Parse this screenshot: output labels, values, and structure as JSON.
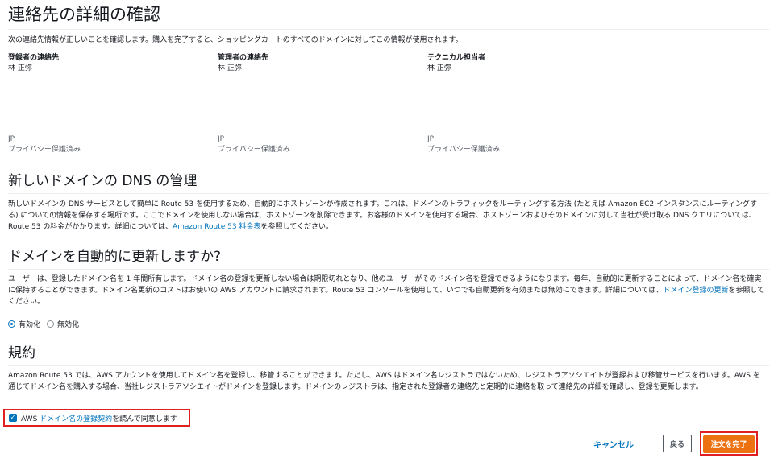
{
  "contact": {
    "title": "連絡先の詳細の確認",
    "desc": "次の連絡先情報が正しいことを確認します。購入を完了すると、ショッピングカートのすべてのドメインに対してこの情報が使用されます。",
    "columns": [
      {
        "heading": "登録者の連絡先",
        "name": "林 正弥",
        "country": "JP",
        "privacy": "プライバシー保護済み"
      },
      {
        "heading": "管理者の連絡先",
        "name": "林 正弥",
        "country": "JP",
        "privacy": "プライバシー保護済み"
      },
      {
        "heading": "テクニカル担当者",
        "name": "林 正弥",
        "country": "JP",
        "privacy": "プライバシー保護済み"
      }
    ]
  },
  "dns": {
    "title": "新しいドメインの DNS の管理",
    "text": "新しいドメインの DNS サービスとして簡単に Route 53 を使用するため、自動的にホストゾーンが作成されます。これは、ドメインのトラフィックをルーティングする方法 (たとえば Amazon EC2 インスタンスにルーティングする) についての情報を保存する場所です。ここでドメインを使用しない場合は、ホストゾーンを削除できます。お客様のドメインを使用する場合、ホストゾーンおよびそのドメインに対して当社が受け取る DNS クエリについては、Route 53 の料金がかかります。詳細については、",
    "link": "Amazon Route 53 料金表",
    "suffix": "を参照してください。"
  },
  "renew": {
    "title": "ドメインを自動的に更新しますか?",
    "text": "ユーザーは、登録したドメイン名を 1 年間所有します。ドメイン名の登録を更新しない場合は期限切れとなり、他のユーザーがそのドメイン名を登録できるようになります。毎年、自動的に更新することによって、ドメイン名を確実に保持することができます。ドメイン名更新のコストはお使いの AWS アカウントに請求されます。Route 53 コンソールを使用して、いつでも自動更新を有効または無効にできます。詳細については、",
    "link": "ドメイン登録の更新",
    "suffix": "を参照してください。",
    "options": {
      "enable": "有効化",
      "disable": "無効化"
    },
    "selected": "enable"
  },
  "terms": {
    "title": "規約",
    "text": "Amazon Route 53 では、AWS アカウントを使用してドメイン名を登録し、移管することができます。ただし、AWS はドメイン名レジストラではないため、レジストラアソシエイトが登録および移管サービスを行います。AWS を通じてドメイン名を購入する場合、当社レジストラアソシエイトがドメインを登録します。ドメインのレジストラは、指定された登録者の連絡先と定期的に連絡を取って連絡先の詳細を確認し、登録を更新します。",
    "agree_prefix": "AWS ",
    "agree_link": "ドメイン名の登録契約",
    "agree_suffix": "を読んで同意します",
    "agreed": true
  },
  "actions": {
    "cancel": "キャンセル",
    "back": "戻る",
    "complete": "注文を完了"
  },
  "colors": {
    "link": "#0073bb",
    "primary": "#ec7211",
    "highlight": "#e02020"
  }
}
